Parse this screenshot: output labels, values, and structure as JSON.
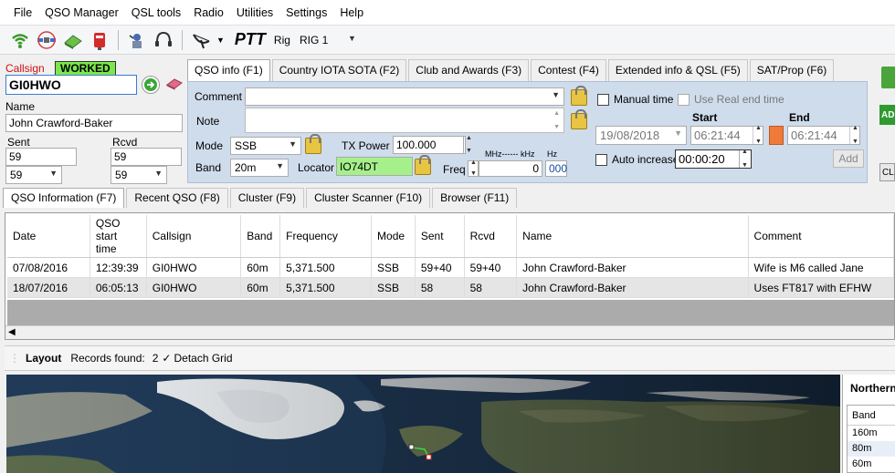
{
  "menu": [
    "File",
    "QSO Manager",
    "QSL tools",
    "Radio",
    "Utilities",
    "Settings",
    "Help"
  ],
  "toolbar": {
    "ptt": "PTT",
    "rig_label": "Rig",
    "rig_value": "RIG 1"
  },
  "left": {
    "callsign_label": "Callsign",
    "worked_badge": "WORKED",
    "callsign_value": "GI0HWO",
    "name_label": "Name",
    "name_value": "John Crawford-Baker",
    "sent_label": "Sent",
    "rcvd_label": "Rcvd",
    "sent_value": "59",
    "rcvd_value": "59",
    "sent_combo": "59",
    "rcvd_combo": "59"
  },
  "qso_tabs": [
    "QSO info (F1)",
    "Country IOTA SOTA (F2)",
    "Club and Awards (F3)",
    "Contest (F4)",
    "Extended info & QSL (F5)",
    "SAT/Prop (F6)"
  ],
  "qso_form": {
    "comment_label": "Comment",
    "note_label": "Note",
    "mode_label": "Mode",
    "mode_value": "SSB",
    "band_label": "Band",
    "band_value": "20m",
    "tx_power_label": "TX Power",
    "tx_power_value": "100.000",
    "locator_label": "Locator",
    "locator_value": "IO74DT",
    "freq_label": "Freq",
    "freq_units": "MHz------ kHz",
    "freq_hz_label": "Hz",
    "freq_value": "0",
    "freq_hz_value": "000",
    "manual_time_label": "Manual time",
    "use_real_end_label": "Use Real end time",
    "start_label": "Start",
    "end_label": "End",
    "date_value": "19/08/2018",
    "start_time": "06:21:44",
    "end_time": "06:21:44",
    "auto_increase_label": "Auto increase",
    "auto_increase_value": "00:00:20",
    "add_button": "Add"
  },
  "right_edge": {
    "add": "AD",
    "clear": "CL"
  },
  "lower_tabs": [
    "QSO Information (F7)",
    "Recent QSO (F8)",
    "Cluster (F9)",
    "Cluster Scanner (F10)",
    "Browser (F11)"
  ],
  "grid": {
    "headers": [
      "Date",
      "QSO start time",
      "Callsign",
      "Band",
      "Frequency",
      "Mode",
      "Sent",
      "Rcvd",
      "Name",
      "Comment"
    ],
    "rows": [
      [
        "07/08/2016",
        "12:39:39",
        "GI0HWO",
        "60m",
        "5,371.500",
        "SSB",
        "59+40",
        "59+40",
        "John Crawford-Baker",
        "Wife is M6 called Jane"
      ],
      [
        "18/07/2016",
        "06:05:13",
        "GI0HWO",
        "60m",
        "5,371.500",
        "SSB",
        "58",
        "58",
        "John Crawford-Baker",
        "Uses FT817 with EFHW"
      ]
    ]
  },
  "layout_bar": {
    "layout_label": "Layout",
    "records_label": "Records found:",
    "records_count": "2",
    "detach_label": "Detach Grid"
  },
  "side_panel": {
    "title": "Northern",
    "band_header": "Band",
    "bands": [
      "160m",
      "80m",
      "60m"
    ]
  },
  "colors": {
    "worked_badge": "#7be84a",
    "locator_bg": "#a6f08c",
    "form_bg": "#cfdcec",
    "accent_orange": "#f07a3a"
  }
}
